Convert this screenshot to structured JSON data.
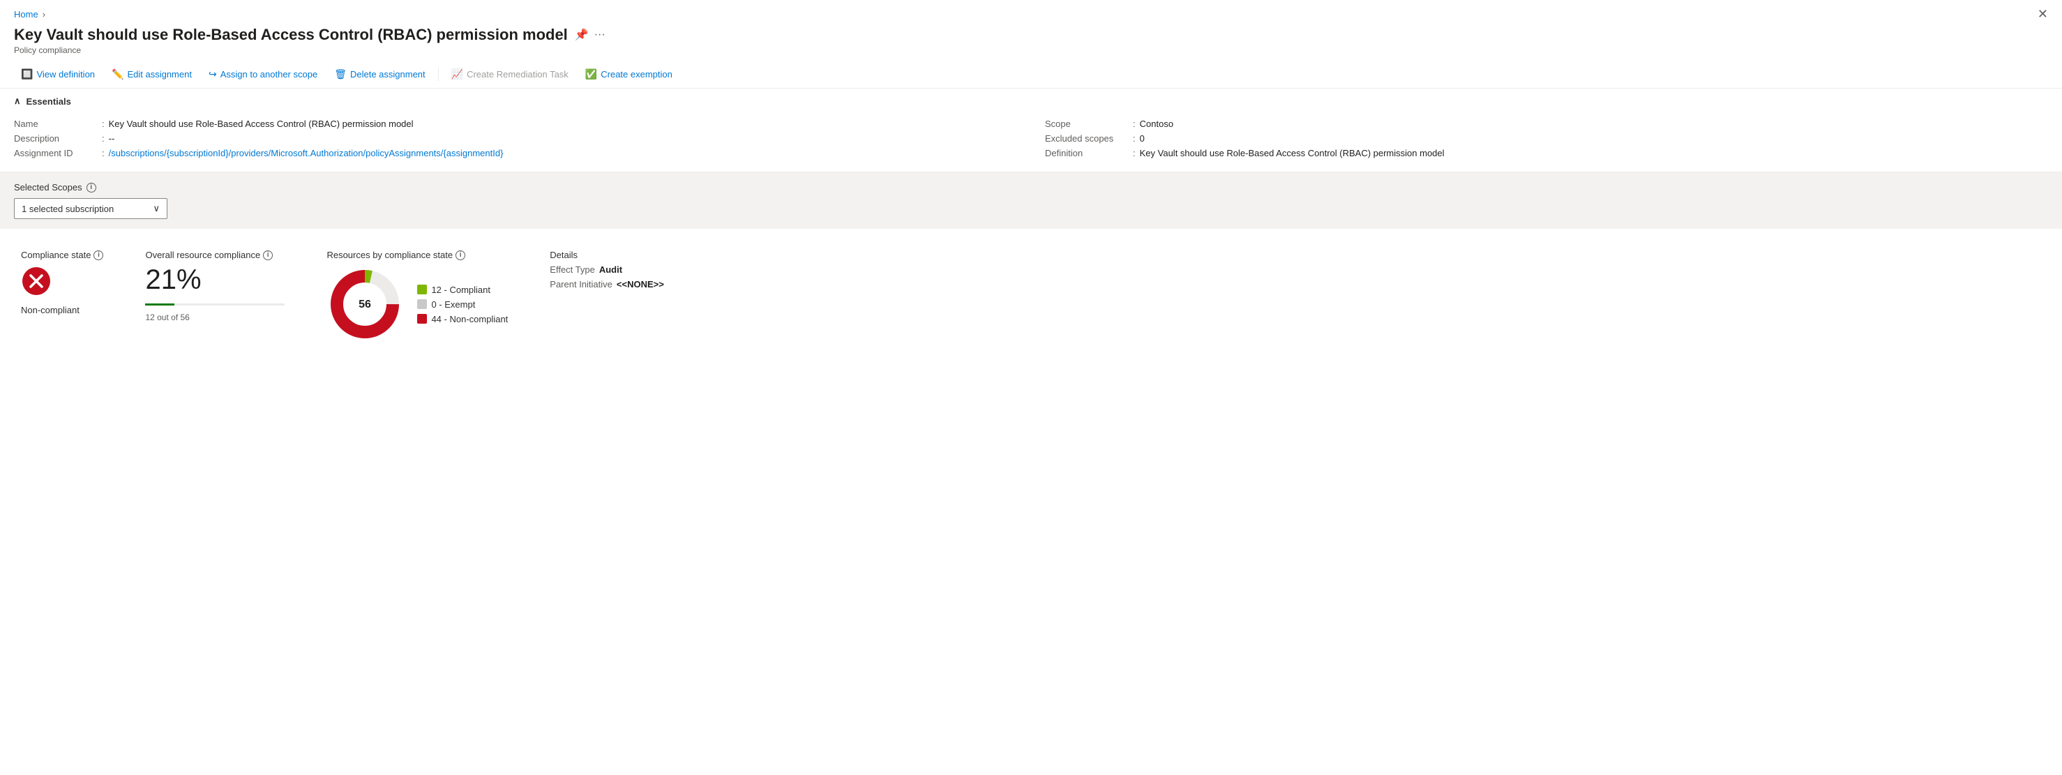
{
  "breadcrumb": {
    "home": "Home",
    "separator": "›"
  },
  "header": {
    "title": "Key Vault should use Role-Based Access Control (RBAC) permission model",
    "subtitle": "Policy compliance"
  },
  "toolbar": {
    "view_definition": "View definition",
    "edit_assignment": "Edit assignment",
    "assign_to_scope": "Assign to another scope",
    "delete_assignment": "Delete assignment",
    "create_remediation": "Create Remediation Task",
    "create_exemption": "Create exemption"
  },
  "essentials": {
    "section_title": "Essentials",
    "fields_left": [
      {
        "label": "Name",
        "value": "Key Vault should use Role-Based Access Control (RBAC) permission model",
        "link": false
      },
      {
        "label": "Description",
        "value": "--",
        "link": false
      },
      {
        "label": "Assignment ID",
        "value": "/subscriptions/{subscriptionId}/providers/Microsoft.Authorization/policyAssignments/{assignmentId}",
        "link": true
      }
    ],
    "fields_right": [
      {
        "label": "Scope",
        "value": "Contoso",
        "link": false
      },
      {
        "label": "Excluded scopes",
        "value": "0",
        "link": false
      },
      {
        "label": "Definition",
        "value": "Key Vault should use Role-Based Access Control (RBAC) permission model",
        "link": false
      }
    ]
  },
  "scope_selector": {
    "label": "Selected Scopes",
    "value": "1 selected subscription"
  },
  "compliance_state": {
    "label": "Compliance state",
    "status": "Non-compliant"
  },
  "overall_compliance": {
    "label": "Overall resource compliance",
    "percentage": "21%",
    "detail": "12 out of 56",
    "progress": 21
  },
  "resources_chart": {
    "label": "Resources by compliance state",
    "total": "56",
    "legend": [
      {
        "label": "12 - Compliant",
        "color": "#7db700"
      },
      {
        "label": "0 - Exempt",
        "color": "#c8c8c8"
      },
      {
        "label": "44 - Non-compliant",
        "color": "#c50f1f"
      }
    ],
    "compliant": 12,
    "exempt": 0,
    "noncompliant": 44
  },
  "details": {
    "label": "Details",
    "effect_type_key": "Effect Type",
    "effect_type_val": "Audit",
    "parent_initiative_key": "Parent Initiative",
    "parent_initiative_val": "<<NONE>>"
  }
}
